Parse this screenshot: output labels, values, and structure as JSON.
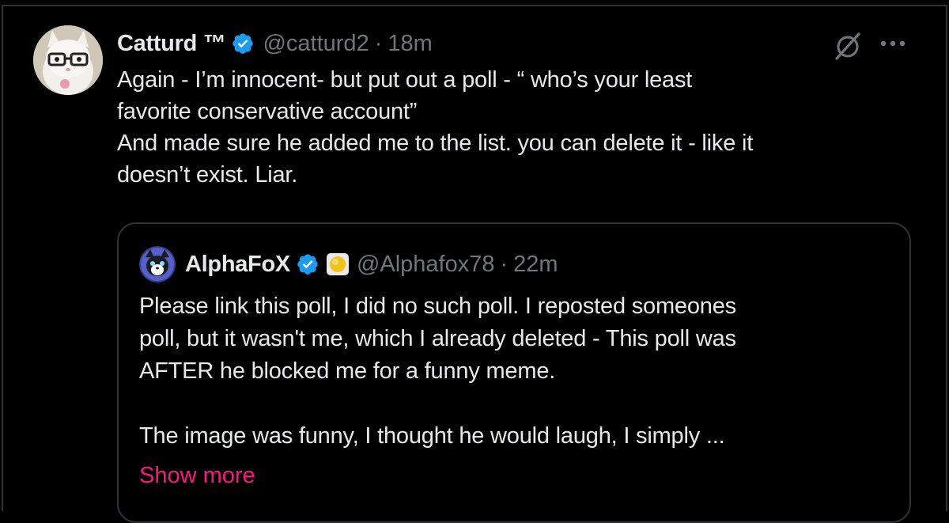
{
  "post": {
    "author": {
      "display_name": "Catturd ™",
      "handle": "@catturd2",
      "separator": "·",
      "time": "18m",
      "avatar_icon": "cat-avatar-icon",
      "verified_color": "#1d9bf0"
    },
    "text": "Again - I’m innocent- but put out a poll - “ who’s your least\nfavorite conservative account”\nAnd made sure he added me to the list. you can delete it - like it\ndoesn’t exist. Liar.",
    "actions": {
      "grok_icon": "grok-icon",
      "more_icon": "more-options-icon"
    }
  },
  "quoted_post": {
    "author": {
      "display_name": "AlphaFoX",
      "handle": "@Alphafox78",
      "separator": "·",
      "time": "22m",
      "avatar_icon": "fox-avatar-icon",
      "badge_icon": "yellow-circle-badge-icon"
    },
    "text": "Please link this poll, I did no such poll. I reposted someones\npoll, but it wasn't me, which I already deleted - This poll was\nAFTER he blocked me for a funny meme.\n\nThe image was funny, I thought he would laugh, I simply ...",
    "show_more_label": "Show more"
  },
  "colors": {
    "background": "#000000",
    "text_primary": "#e7e9ea",
    "text_secondary": "#71767b",
    "link_pink": "#f91880",
    "border": "#2f3336"
  }
}
